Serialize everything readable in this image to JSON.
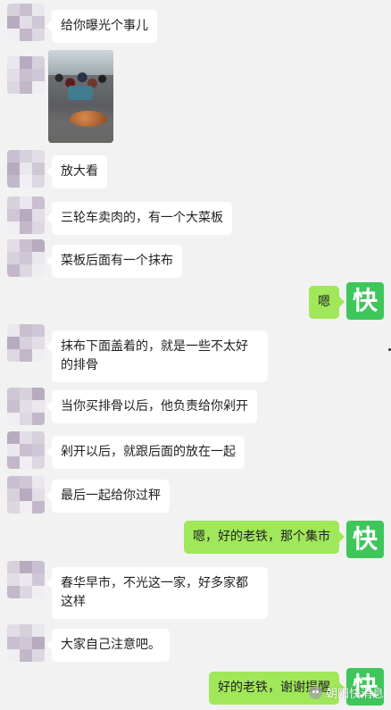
{
  "messages": [
    {
      "side": "left",
      "type": "text",
      "text": "给你曝光个事儿"
    },
    {
      "side": "left",
      "type": "image",
      "icon": "market-photo"
    },
    {
      "side": "left",
      "type": "text",
      "text": "放大看"
    },
    {
      "side": "left",
      "type": "text",
      "text": "三轮车卖肉的，有一个大菜板"
    },
    {
      "side": "left",
      "type": "text",
      "text": "菜板后面有一个抹布"
    },
    {
      "side": "right",
      "type": "text",
      "text": "嗯"
    },
    {
      "side": "left",
      "type": "text",
      "text": "抹布下面盖着的，就是一些不太好的排骨"
    },
    {
      "side": "left",
      "type": "text",
      "text": "当你买排骨以后，他负责给你剁开"
    },
    {
      "side": "left",
      "type": "text",
      "text": "剁开以后，就跟后面的放在一起"
    },
    {
      "side": "left",
      "type": "text",
      "text": "最后一起给你过秤"
    },
    {
      "side": "right",
      "type": "text",
      "text": "嗯，好的老铁，那个集市"
    },
    {
      "side": "left",
      "type": "text",
      "text": "春华早市，不光这一家，好多家都这样"
    },
    {
      "side": "left",
      "type": "text",
      "text": "大家自己注意吧。"
    },
    {
      "side": "right",
      "type": "text",
      "text": "好的老铁，谢谢提醒"
    }
  ],
  "right_avatar": {
    "label": "快",
    "color": "#3fc65b"
  },
  "watermark": {
    "text": "朝阳快消息",
    "icon": "wechat-icon"
  }
}
